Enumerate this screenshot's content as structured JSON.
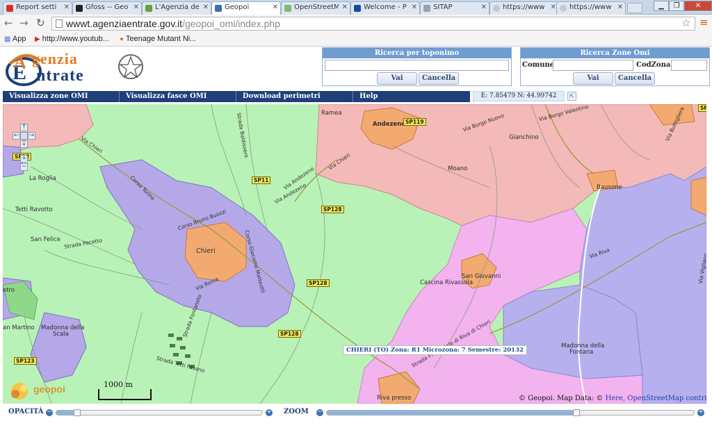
{
  "browser": {
    "tabs": [
      {
        "label": "Report setti",
        "icon": "gmail-icon",
        "color": "#d93025"
      },
      {
        "label": "Gfoss -- Geo",
        "icon": "notion-n-icon",
        "color": "#222222"
      },
      {
        "label": "L'Agenzia de",
        "icon": "map-favicon-icon",
        "color": "#6a9e3d"
      },
      {
        "label": "Geopoi",
        "icon": "geopoi-favicon-icon",
        "color": "#3a6fb0",
        "active": true
      },
      {
        "label": "OpenStreetM",
        "icon": "osm-favicon-icon",
        "color": "#7ebc6f"
      },
      {
        "label": "Welcome - P",
        "icon": "search-favicon-icon",
        "color": "#1a4a9c"
      },
      {
        "label": "SITAP",
        "icon": "document-favicon-icon",
        "color": "#9aa0a6"
      },
      {
        "label": "https://www",
        "icon": "loading-icon",
        "color": "#9aa0a6"
      },
      {
        "label": "https://www",
        "icon": "loading-icon",
        "color": "#9aa0a6"
      }
    ],
    "url_host": "wwwt.agenziaentrate.gov.it",
    "url_path": "/geopoi_omi/index.php",
    "bookmarks": [
      {
        "label": "App",
        "icon": "apps-grid-icon"
      },
      {
        "label": "http://www.youtub...",
        "icon": "youtube-icon"
      },
      {
        "label": "Teenage Mutant Ni...",
        "icon": "bookmark-favicon-icon"
      }
    ]
  },
  "header": {
    "logo_text_top": "genzia",
    "logo_text_bottom": "ntrate",
    "brand_color": "#1e3f78",
    "accent_color": "#e07b22"
  },
  "search_toponym": {
    "title": "Ricerca per toponimo",
    "value": "",
    "go_label": "Vai",
    "cancel_label": "Cancella"
  },
  "search_zones": {
    "title": "Ricerca Zone Omi",
    "comune_label": "Comune:",
    "comune_value": "",
    "codzona_label": "CodZona:",
    "codzona_value": "",
    "go_label": "Vai",
    "cancel_label": "Cancella"
  },
  "nav": {
    "items": [
      "Visualizza zone OMI",
      "Visualizza fasce OMI",
      "Download perimetri",
      "Help"
    ]
  },
  "coords": "E: 7.85479  N: 44.99742",
  "map": {
    "place_labels": [
      "Ramea",
      "Andezeno",
      "Gianchino",
      "Moano",
      "Bausone",
      "La Roglia",
      "Tetti Ravotto",
      "San Felice",
      "Chieri",
      "San Giovanni",
      "Cascina Rivassola",
      "Madonna della",
      "Scala",
      "an Martino",
      "etro",
      "Madonna della",
      "Fontana",
      "Riva presso"
    ],
    "street_labels": [
      "Via Chieri",
      "Corso Torino",
      "Strada Baldissero",
      "Via Andezeno",
      "Corso Bruno Buozzi",
      "Strada Pecetto",
      "Via Roma",
      "Corso Giacomo Matteotti",
      "Strada Fontaneto",
      "Strada Tetti Fasano",
      "Via Borgo Nuovo",
      "Via Borgo Valentino",
      "Via Riva",
      "Via Buttigliera",
      "Strada Provinciale di Riva di Chieri",
      "Via Vigliano",
      "Via Chieri",
      "Via Andezeno"
    ],
    "road_badges": [
      "SP11",
      "SP128",
      "SP128",
      "SP128",
      "SP119",
      "SP123",
      "SP12",
      "SP"
    ],
    "popup": "CHIERI (TO) Zona: R1 Microzona: 7 Semestre: 20132",
    "scale_label": "1000 m",
    "attribution_prefix": "© Geopoi. Map Data: ©",
    "attribution_links": "Here, OpenStreetMap contributors",
    "geopoi_logo_text": "geopoi",
    "zone_colors": {
      "green": "#b9f2b6",
      "red": "#f4b9b9",
      "purple": "#f2b3ee",
      "blue": "#b7b0ef",
      "urban_purple": "#b5a8e8",
      "center_orange": "#f3aa70"
    }
  },
  "bottom": {
    "opacity_label": "OPACITÀ",
    "zoom_label": "ZOOM",
    "opacity_level": 0.1,
    "zoom_level": 0.68
  }
}
